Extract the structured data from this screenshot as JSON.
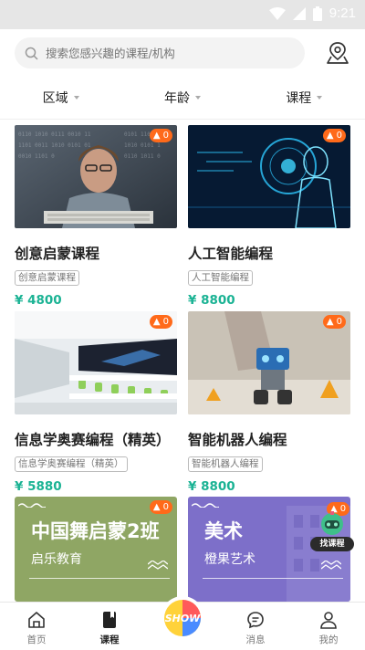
{
  "status": {
    "time": "9:21"
  },
  "search": {
    "placeholder": "搜索您感兴趣的课程/机构"
  },
  "filters": [
    {
      "label": "区域"
    },
    {
      "label": "年龄"
    },
    {
      "label": "课程"
    }
  ],
  "cards": [
    {
      "title": "创意启蒙课程",
      "tag": "创意启蒙课程",
      "price": "¥ 4800",
      "hot": "0"
    },
    {
      "title": "人工智能编程",
      "tag": "人工智能编程",
      "price": "¥ 8800",
      "hot": "0"
    },
    {
      "title": "信息学奥赛编程（精英）",
      "tag": "信息学奥赛编程（精英）",
      "price": "¥ 5880",
      "hot": "0"
    },
    {
      "title": "智能机器人编程",
      "tag": "智能机器人编程",
      "price": "¥ 8800",
      "hot": "0"
    }
  ],
  "banners": [
    {
      "title": "中国舞启蒙2班",
      "sub": "启乐教育",
      "hot": "0",
      "color": "#8fa664"
    },
    {
      "title": "美术",
      "sub": "橙果艺术",
      "hot": "0",
      "color": "#7d6fc9"
    }
  ],
  "floaty": {
    "label": "找课程"
  },
  "nav": [
    {
      "label": "首页"
    },
    {
      "label": "课程"
    },
    {
      "label": "SHOW"
    },
    {
      "label": "消息"
    },
    {
      "label": "我的"
    }
  ]
}
